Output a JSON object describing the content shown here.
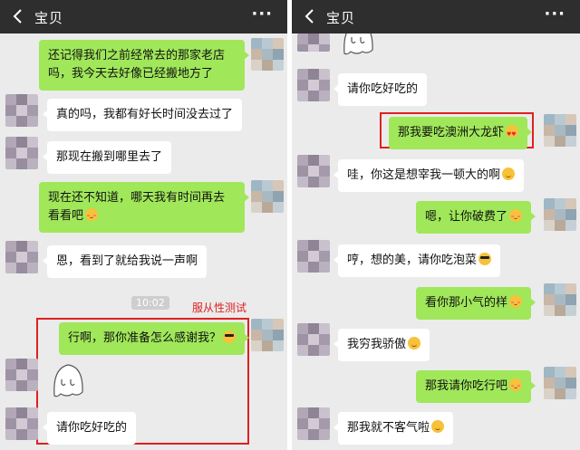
{
  "left": {
    "title": "宝贝",
    "more": "···",
    "messages": [
      {
        "side": "out",
        "text1": "还记得我们之前经常去的那家老店",
        "text2": "吗，我今天去好像已经搬地方了"
      },
      {
        "side": "in",
        "text": "真的吗，我都有好长时间没去过了"
      },
      {
        "side": "in",
        "text": "那现在搬到哪里去了"
      },
      {
        "side": "out",
        "text1": "现在还不知道，哪天我有时间再去",
        "text2": "看看吧"
      },
      {
        "side": "in",
        "text": "恩，看到了就给我说一声啊"
      },
      {
        "side": "out",
        "text": "行啊，那你准备怎么感谢我？"
      },
      {
        "side": "in",
        "text": "请你吃好吃的"
      }
    ],
    "timestamp": "10:02",
    "annotation": "服从性测试"
  },
  "right": {
    "title": "宝贝",
    "more": "···",
    "messages": [
      {
        "side": "in",
        "text": "请你吃好吃的"
      },
      {
        "side": "out",
        "text": "那我要吃澳洲大龙虾"
      },
      {
        "side": "in",
        "text": "哇，你这是想宰我一顿大的啊"
      },
      {
        "side": "out",
        "text": "嗯，让你破费了"
      },
      {
        "side": "in",
        "text": "哼，想的美，请你吃泡菜"
      },
      {
        "side": "out",
        "text": "看你那小气的样"
      },
      {
        "side": "in",
        "text": "我穷我骄傲"
      },
      {
        "side": "out",
        "text": "那我请你吃行吧"
      },
      {
        "side": "in",
        "text": "那我就不客气啦"
      }
    ]
  },
  "colors": {
    "topbar": "#2e2e2e",
    "background": "#ebebeb",
    "bubble_out": "#a0e75a",
    "bubble_in": "#ffffff",
    "highlight": "#e02020"
  },
  "icons": {
    "back": "chevron-left-icon",
    "more": "more-dots-icon",
    "sticker": "ghost-sticker-icon"
  }
}
